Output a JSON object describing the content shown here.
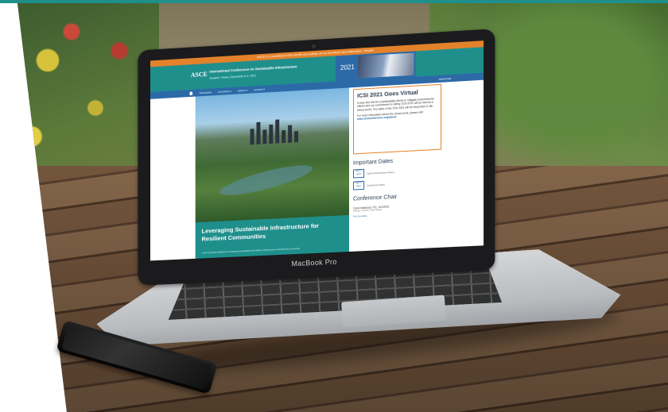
{
  "laptop": {
    "brand_label": "MacBook Pro"
  },
  "website": {
    "alert_bar": "ASCE is committed to the health and safety of our members and attendees. Details",
    "logo": "ASCE",
    "conference_title": "International Conference on Sustainable Infrastructure",
    "conference_subtitle": "Houston, Texas | December 6–9, 2021",
    "year": "2021",
    "nav": {
      "items": [
        "PROGRAM",
        "LOCATION ▾",
        "ABOUT ▾",
        "CONTACT"
      ],
      "right": "REGISTER"
    },
    "hero_title": "Leveraging Sustainable Infrastructure for Resilient Communities",
    "hero_desc": "Learn the global implications of integrating sustainable and resilient infrastructure to benefit every community.",
    "virtual_box": {
      "heading": "ICSI 2021 Goes Virtual",
      "body": "In lean into ASCE's sustainability efforts to mitigate environmental effects and our commitment to safety, ICSI 2021 will be held as a virtual event. The dates of the ICSI 2021 will be December 6–9th.",
      "more": "For more information about the virtual event, please visit",
      "link": "www.icsiconference.org/about"
    },
    "important_dates": {
      "title": "Important Dates",
      "rows": [
        {
          "date": "OCT 1 2021",
          "label": "Call for Submissions Opens"
        },
        {
          "date": "DEC 6 2021",
          "label": "Conference Starts"
        }
      ]
    },
    "chair": {
      "title": "Conference Chair",
      "name": "Carol Haddock, P.E., M.ASCE",
      "role": "Director, Houston Public Works",
      "link": "Full Committee"
    }
  },
  "colors": {
    "teal": "#1f8f8c",
    "blue": "#2b6aa7",
    "orange": "#e3822b"
  }
}
